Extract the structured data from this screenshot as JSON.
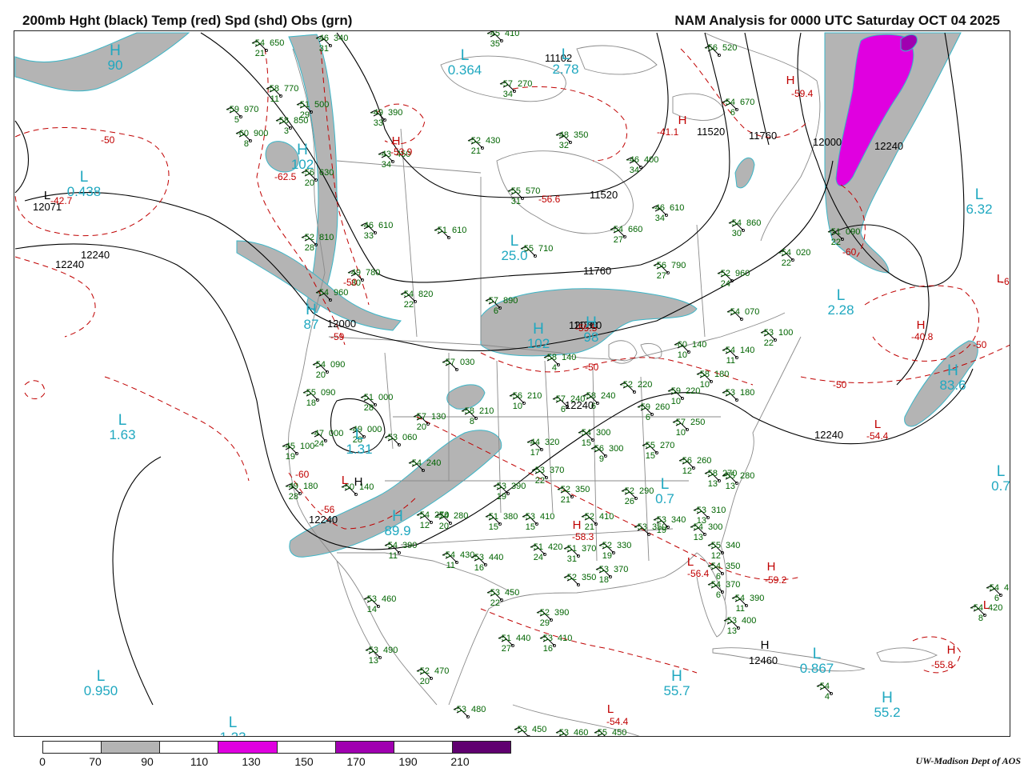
{
  "header": {
    "left_title": "200mb Hght (black) Temp (red) Spd (shd) Obs (grn)",
    "right_title": "NAM Analysis for 0000 UTC Saturday  OCT 04 2025"
  },
  "legend": {
    "labels": [
      "0",
      "70",
      "90",
      "110",
      "130",
      "150",
      "170",
      "190",
      "210"
    ],
    "segment_colors": [
      "#ffffff",
      "#b4b4b4",
      "#ffffff",
      "#e000e0",
      "#ffffff",
      "#a000b0",
      "#ffffff",
      "#600070"
    ]
  },
  "credit": "UW-Madison  Dept of AOS",
  "colors": {
    "height_contour": "#000000",
    "temperature_contour": "#c00000",
    "speed_70_90": "#b4b4b4",
    "speed_110_130": "#e000e0",
    "speed_130_150": "#a000b0",
    "obs": "#006400",
    "pressure_centers": "#20a8c0",
    "map_borders": "#808080"
  },
  "height_labels": [
    "12071",
    "12240",
    "12240",
    "12000",
    "11760",
    "11520",
    "11520",
    "11760",
    "12000",
    "12240",
    "11760",
    "12080",
    "12240",
    "12240",
    "12240",
    "12460",
    "11102"
  ],
  "temperature_labels": [
    "-50",
    "-42.7",
    "-62.5",
    "-50",
    "-59",
    "-60",
    "-41.1",
    "-59.4",
    "-56.6",
    "-50",
    "-60",
    "-40.8",
    "-50",
    "-50",
    "-54.4",
    "-56",
    "-56.4",
    "-59.2",
    "-55.8",
    "-54.4",
    "-53.9",
    "-58.3",
    "-59.5",
    "-60"
  ],
  "centers": [
    {
      "letter": "H",
      "value": "90",
      "color": "cyan"
    },
    {
      "letter": "L",
      "value": "0.438",
      "color": "cyan"
    },
    {
      "letter": "L",
      "value": "0.364",
      "color": "cyan"
    },
    {
      "letter": "L",
      "value": "2.78",
      "color": "cyan"
    },
    {
      "letter": "H",
      "value": "102",
      "color": "cyan"
    },
    {
      "letter": "L",
      "value": "25.0",
      "color": "cyan"
    },
    {
      "letter": "L",
      "value": "6.32",
      "color": "cyan"
    },
    {
      "letter": "L",
      "value": "2.28",
      "color": "cyan"
    },
    {
      "letter": "H",
      "value": "87",
      "color": "cyan"
    },
    {
      "letter": "H",
      "value": "102",
      "color": "cyan"
    },
    {
      "letter": "H",
      "value": "98",
      "color": "cyan"
    },
    {
      "letter": "L",
      "value": "1.63",
      "color": "cyan"
    },
    {
      "letter": "H",
      "value": "83.6",
      "color": "cyan"
    },
    {
      "letter": "L",
      "value": "1.31",
      "color": "cyan"
    },
    {
      "letter": "H",
      "value": "89.9",
      "color": "cyan"
    },
    {
      "letter": "L",
      "value": "0.7",
      "color": "cyan"
    },
    {
      "letter": "L",
      "value": "0.7",
      "color": "cyan"
    },
    {
      "letter": "L",
      "value": "0.950",
      "color": "cyan"
    },
    {
      "letter": "L",
      "value": "0.867",
      "color": "cyan"
    },
    {
      "letter": "H",
      "value": "55.7",
      "color": "cyan"
    },
    {
      "letter": "H",
      "value": "55.2",
      "color": "cyan"
    },
    {
      "letter": "L",
      "value": "1.23",
      "color": "cyan"
    },
    {
      "letter": "H",
      "value": "",
      "color": "black"
    },
    {
      "letter": "L",
      "value": "",
      "color": "black"
    },
    {
      "letter": "H",
      "value": "",
      "color": "black"
    },
    {
      "letter": "H",
      "value": "",
      "color": "red"
    },
    {
      "letter": "H",
      "value": "",
      "color": "red"
    },
    {
      "letter": "H",
      "value": "",
      "color": "red"
    },
    {
      "letter": "L",
      "value": "",
      "color": "red"
    },
    {
      "letter": "L",
      "value": "",
      "color": "red"
    },
    {
      "letter": "L",
      "value": "",
      "color": "red"
    },
    {
      "letter": "H",
      "value": "",
      "color": "red"
    },
    {
      "letter": "H",
      "value": "",
      "color": "red"
    },
    {
      "letter": "L",
      "value": "",
      "color": "red"
    },
    {
      "letter": "H",
      "value": "",
      "color": "red"
    },
    {
      "letter": "L",
      "value": "",
      "color": "red"
    },
    {
      "letter": "H",
      "value": "",
      "color": "red"
    },
    {
      "letter": "L",
      "value": "",
      "color": "red"
    }
  ],
  "observations": [
    {
      "temp": "-54",
      "height": "650",
      "dep": "21"
    },
    {
      "temp": "-46",
      "height": "340",
      "dep": "31"
    },
    {
      "temp": "-45",
      "height": "410",
      "dep": "35"
    },
    {
      "temp": "-58",
      "height": "770",
      "dep": "11"
    },
    {
      "temp": "-51",
      "height": "500",
      "dep": "29"
    },
    {
      "temp": "-59",
      "height": "970",
      "dep": "5"
    },
    {
      "temp": "-58",
      "height": "850",
      "dep": "3"
    },
    {
      "temp": "-60",
      "height": "900",
      "dep": "8"
    },
    {
      "temp": "-49",
      "height": "390",
      "dep": "33"
    },
    {
      "temp": "-57",
      "height": "270",
      "dep": "34"
    },
    {
      "temp": "-52",
      "height": "430",
      "dep": "21"
    },
    {
      "temp": "-48",
      "height": "350",
      "dep": "32"
    },
    {
      "temp": "-56",
      "height": "520",
      "dep": ""
    },
    {
      "temp": "-54",
      "height": "670",
      "dep": "6"
    },
    {
      "temp": "-43",
      "height": "450",
      "dep": "34"
    },
    {
      "temp": "-56",
      "height": "630",
      "dep": "20"
    },
    {
      "temp": "-46",
      "height": "400",
      "dep": "34"
    },
    {
      "temp": "-55",
      "height": "570",
      "dep": "31"
    },
    {
      "temp": "-46",
      "height": "610",
      "dep": "34"
    },
    {
      "temp": "-46",
      "height": "610",
      "dep": "33"
    },
    {
      "temp": "-51",
      "height": "610",
      "dep": ""
    },
    {
      "temp": "-52",
      "height": "810",
      "dep": "28"
    },
    {
      "temp": "-55",
      "height": "710",
      "dep": ""
    },
    {
      "temp": "-54",
      "height": "660",
      "dep": "27"
    },
    {
      "temp": "-54",
      "height": "860",
      "dep": "30"
    },
    {
      "temp": "-51",
      "height": "090",
      "dep": "22"
    },
    {
      "temp": "-49",
      "height": "780",
      "dep": "30"
    },
    {
      "temp": "-56",
      "height": "790",
      "dep": "27"
    },
    {
      "temp": "-54",
      "height": "020",
      "dep": "22"
    },
    {
      "temp": "-52",
      "height": "960",
      "dep": "24"
    },
    {
      "temp": "-54",
      "height": "960",
      "dep": ""
    },
    {
      "temp": "-54",
      "height": "820",
      "dep": "22"
    },
    {
      "temp": "-57",
      "height": "890",
      "dep": "6"
    },
    {
      "temp": "-54",
      "height": "070",
      "dep": ""
    },
    {
      "temp": "-53",
      "height": "100",
      "dep": "22"
    },
    {
      "temp": "-60",
      "height": "140",
      "dep": "10"
    },
    {
      "temp": "-54",
      "height": "140",
      "dep": "11"
    },
    {
      "temp": "-58",
      "height": "140",
      "dep": "4"
    },
    {
      "temp": "-54",
      "height": "090",
      "dep": "20"
    },
    {
      "temp": "-57",
      "height": "030",
      "dep": ""
    },
    {
      "temp": "-58",
      "height": "180",
      "dep": "10"
    },
    {
      "temp": "-53",
      "height": "180",
      "dep": ""
    },
    {
      "temp": "-55",
      "height": "090",
      "dep": "18"
    },
    {
      "temp": "-51",
      "height": "000",
      "dep": "28"
    },
    {
      "temp": "-56",
      "height": "210",
      "dep": "10"
    },
    {
      "temp": "-57",
      "height": "240",
      "dep": "6"
    },
    {
      "temp": "-58",
      "height": "240",
      "dep": "6"
    },
    {
      "temp": "-52",
      "height": "220",
      "dep": ""
    },
    {
      "temp": "-59",
      "height": "220",
      "dep": "10"
    },
    {
      "temp": "-59",
      "height": "260",
      "dep": "6"
    },
    {
      "temp": "-58",
      "height": "210",
      "dep": "8"
    },
    {
      "temp": "-57",
      "height": "130",
      "dep": "20"
    },
    {
      "temp": "-57",
      "height": "250",
      "dep": "10"
    },
    {
      "temp": "-47",
      "height": "000",
      "dep": "24"
    },
    {
      "temp": "-49",
      "height": "000",
      "dep": "28"
    },
    {
      "temp": "-53",
      "height": "060",
      "dep": ""
    },
    {
      "temp": "-44",
      "height": "320",
      "dep": "17"
    },
    {
      "temp": "-54",
      "height": "300",
      "dep": "15"
    },
    {
      "temp": "-56",
      "height": "300",
      "dep": "9"
    },
    {
      "temp": "-55",
      "height": "270",
      "dep": "15"
    },
    {
      "temp": "-56",
      "height": "260",
      "dep": "12"
    },
    {
      "temp": "-45",
      "height": "100",
      "dep": "19"
    },
    {
      "temp": "-54",
      "height": "240",
      "dep": ""
    },
    {
      "temp": "-53",
      "height": "370",
      "dep": "22"
    },
    {
      "temp": "-58",
      "height": "270",
      "dep": "13"
    },
    {
      "temp": "-55",
      "height": "280",
      "dep": "13"
    },
    {
      "temp": "-49",
      "height": "180",
      "dep": "28"
    },
    {
      "temp": "-50",
      "height": "140",
      "dep": ""
    },
    {
      "temp": "-53",
      "height": "390",
      "dep": "19"
    },
    {
      "temp": "-52",
      "height": "350",
      "dep": "21"
    },
    {
      "temp": "-52",
      "height": "290",
      "dep": "26"
    },
    {
      "temp": "-53",
      "height": "310",
      "dep": "13"
    },
    {
      "temp": "-54",
      "height": "270",
      "dep": "12"
    },
    {
      "temp": "-54",
      "height": "280",
      "dep": "20"
    },
    {
      "temp": "-51",
      "height": "380",
      "dep": "15"
    },
    {
      "temp": "-53",
      "height": "410",
      "dep": "15"
    },
    {
      "temp": "-52",
      "height": "410",
      "dep": "21"
    },
    {
      "temp": "-53",
      "height": "350",
      "dep": ""
    },
    {
      "temp": "-53",
      "height": "340",
      "dep": "19"
    },
    {
      "temp": "-54",
      "height": "300",
      "dep": "13"
    },
    {
      "temp": "-55",
      "height": "340",
      "dep": "12"
    },
    {
      "temp": "-54",
      "height": "390",
      "dep": "11"
    },
    {
      "temp": "-54",
      "height": "430",
      "dep": "11"
    },
    {
      "temp": "-53",
      "height": "440",
      "dep": "16"
    },
    {
      "temp": "-51",
      "height": "420",
      "dep": "24"
    },
    {
      "temp": "-51",
      "height": "370",
      "dep": "31"
    },
    {
      "temp": "-52",
      "height": "330",
      "dep": "19"
    },
    {
      "temp": "-54",
      "height": "350",
      "dep": "6"
    },
    {
      "temp": "-53",
      "height": "370",
      "dep": "18"
    },
    {
      "temp": "-52",
      "height": "350",
      "dep": ""
    },
    {
      "temp": "-53",
      "height": "460",
      "dep": "14"
    },
    {
      "temp": "-53",
      "height": "450",
      "dep": "22"
    },
    {
      "temp": "-52",
      "height": "390",
      "dep": "29"
    },
    {
      "temp": "-51",
      "height": "440",
      "dep": "27"
    },
    {
      "temp": "-53",
      "height": "410",
      "dep": "16"
    },
    {
      "temp": "-54",
      "height": "390",
      "dep": "11"
    },
    {
      "temp": "-53",
      "height": "400",
      "dep": "13"
    },
    {
      "temp": "-54",
      "height": "370",
      "dep": "6"
    },
    {
      "temp": "-53",
      "height": "490",
      "dep": "13"
    },
    {
      "temp": "-52",
      "height": "470",
      "dep": "20"
    },
    {
      "temp": "-53",
      "height": "480",
      "dep": ""
    },
    {
      "temp": "-53",
      "height": "450",
      "dep": ""
    },
    {
      "temp": "-53",
      "height": "460",
      "dep": ""
    },
    {
      "temp": "-54",
      "height": "420",
      "dep": "8"
    },
    {
      "temp": "-54",
      "height": "",
      "dep": "4"
    },
    {
      "temp": "-54",
      "height": "4",
      "dep": "6"
    },
    {
      "temp": "-55",
      "height": "450",
      "dep": ""
    }
  ]
}
